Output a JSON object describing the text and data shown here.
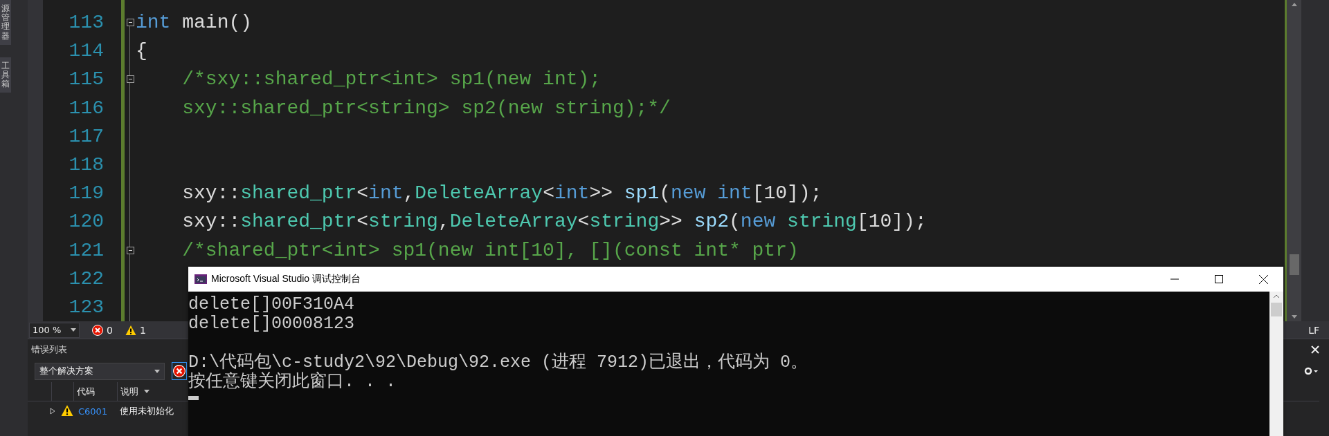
{
  "side_tabs": [
    {
      "label": "源管理器"
    },
    {
      "label": "工具箱"
    }
  ],
  "editor": {
    "lines": [
      {
        "number": "113",
        "fold": true,
        "tokens": [
          {
            "kind": "keyword",
            "text": "int"
          },
          {
            "kind": "plain",
            "text": " main()"
          }
        ]
      },
      {
        "number": "114",
        "fold": false,
        "tokens": [
          {
            "kind": "plain",
            "text": "{"
          }
        ]
      },
      {
        "number": "115",
        "fold": true,
        "tokens": [
          {
            "kind": "comment",
            "text": "    /*sxy::shared_ptr<int> sp1(new int);"
          }
        ]
      },
      {
        "number": "116",
        "fold": false,
        "tokens": [
          {
            "kind": "comment",
            "text": "    sxy::shared_ptr<string> sp2(new string);*/"
          }
        ]
      },
      {
        "number": "117",
        "fold": false
      },
      {
        "number": "118",
        "fold": false
      },
      {
        "number": "119",
        "fold": false,
        "tokens": [
          {
            "kind": "plain",
            "text": "    sxy::"
          },
          {
            "kind": "type",
            "text": "shared_ptr"
          },
          {
            "kind": "plain",
            "text": "<"
          },
          {
            "kind": "keyword",
            "text": "int"
          },
          {
            "kind": "plain",
            "text": ","
          },
          {
            "kind": "type",
            "text": "DeleteArray"
          },
          {
            "kind": "plain",
            "text": "<"
          },
          {
            "kind": "keyword",
            "text": "int"
          },
          {
            "kind": "plain",
            "text": ">> "
          },
          {
            "kind": "variable",
            "text": "sp1"
          },
          {
            "kind": "plain",
            "text": "("
          },
          {
            "kind": "keyword",
            "text": "new int"
          },
          {
            "kind": "plain",
            "text": "[10]);"
          }
        ]
      },
      {
        "number": "120",
        "fold": false,
        "tokens": [
          {
            "kind": "plain",
            "text": "    sxy::"
          },
          {
            "kind": "type",
            "text": "shared_ptr"
          },
          {
            "kind": "plain",
            "text": "<"
          },
          {
            "kind": "type",
            "text": "string"
          },
          {
            "kind": "plain",
            "text": ","
          },
          {
            "kind": "type",
            "text": "DeleteArray"
          },
          {
            "kind": "plain",
            "text": "<"
          },
          {
            "kind": "type",
            "text": "string"
          },
          {
            "kind": "plain",
            "text": ">> "
          },
          {
            "kind": "variable",
            "text": "sp2"
          },
          {
            "kind": "plain",
            "text": "("
          },
          {
            "kind": "keyword",
            "text": "new"
          },
          {
            "kind": "type",
            "text": " string"
          },
          {
            "kind": "plain",
            "text": "[10]);"
          }
        ]
      },
      {
        "number": "121",
        "fold": true,
        "tokens": [
          {
            "kind": "comment",
            "text": "    /*shared_ptr<int> sp1(new int[10], [](const int* ptr)"
          }
        ]
      },
      {
        "number": "122",
        "fold": false
      },
      {
        "number": "123",
        "fold": false
      }
    ]
  },
  "status_bar": {
    "zoom": "100 %",
    "errors": "0",
    "warnings": "1",
    "line_ending": "LF"
  },
  "error_list": {
    "title": "错误列表",
    "scope": "整个解决方案",
    "columns": [
      "代码",
      "说明"
    ],
    "rows": [
      {
        "kind": "warning",
        "expanded": false,
        "code": "C6001",
        "description": "使用未初始化"
      }
    ]
  },
  "console": {
    "title": "Microsoft Visual Studio 调试控制台",
    "paragraphs": [
      [
        "delete[]00F310A4",
        "delete[]00008123"
      ],
      [
        "D:\\代码包\\c-study2\\92\\Debug\\92.exe (进程 7912)已退出，代码为 0。",
        "按任意键关闭此窗口. . ."
      ]
    ]
  }
}
